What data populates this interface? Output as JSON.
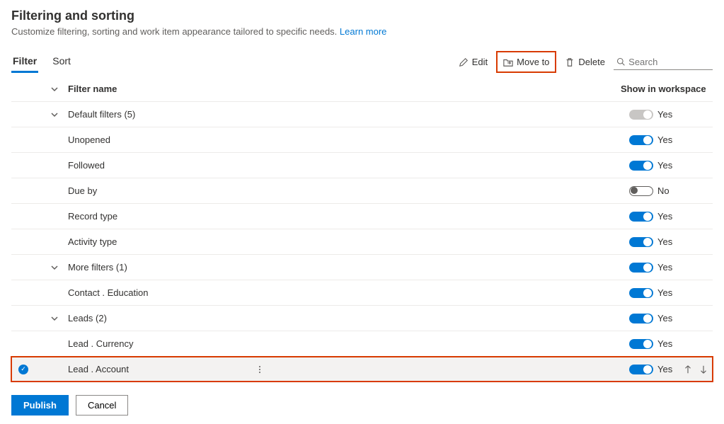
{
  "header": {
    "title": "Filtering and sorting",
    "subtitle": "Customize filtering, sorting and work item appearance tailored to specific needs.",
    "learn_more": "Learn more"
  },
  "tabs": {
    "filter": "Filter",
    "sort": "Sort"
  },
  "toolbar": {
    "edit": "Edit",
    "move_to": "Move to",
    "delete": "Delete",
    "search_placeholder": "Search"
  },
  "columns": {
    "filter_name": "Filter name",
    "show_in_workspace": "Show in workspace"
  },
  "rows": [
    {
      "type": "group",
      "name": "Default filters (5)",
      "expanded": true,
      "toggle": "disabled-on",
      "label": "Yes"
    },
    {
      "type": "item",
      "name": "Unopened",
      "toggle": "on",
      "label": "Yes"
    },
    {
      "type": "item",
      "name": "Followed",
      "toggle": "on",
      "label": "Yes"
    },
    {
      "type": "item",
      "name": "Due by",
      "toggle": "off",
      "label": "No"
    },
    {
      "type": "item",
      "name": "Record type",
      "toggle": "on",
      "label": "Yes"
    },
    {
      "type": "item",
      "name": "Activity type",
      "toggle": "on",
      "label": "Yes"
    },
    {
      "type": "group",
      "name": "More filters (1)",
      "expanded": true,
      "toggle": "on",
      "label": "Yes"
    },
    {
      "type": "item",
      "name": "Contact . Education",
      "toggle": "on",
      "label": "Yes"
    },
    {
      "type": "group",
      "name": "Leads (2)",
      "expanded": true,
      "toggle": "on",
      "label": "Yes"
    },
    {
      "type": "item",
      "name": "Lead . Currency",
      "toggle": "on",
      "label": "Yes"
    },
    {
      "type": "item",
      "name": "Lead . Account",
      "toggle": "on",
      "label": "Yes",
      "selected": true
    }
  ],
  "footer": {
    "publish": "Publish",
    "cancel": "Cancel"
  }
}
